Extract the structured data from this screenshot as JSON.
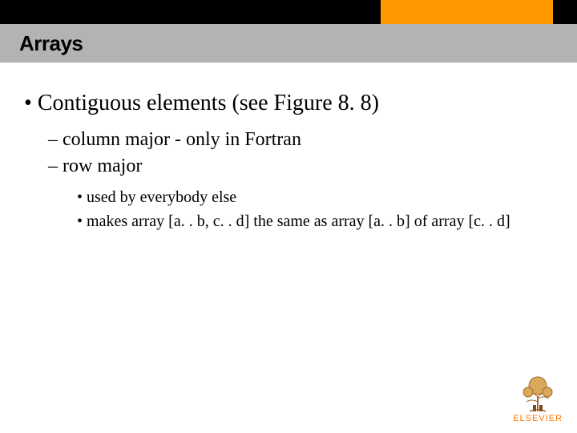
{
  "header": {
    "title": "Arrays"
  },
  "content": {
    "b1": "Contiguous elements (see Figure 8. 8)",
    "b1_1": "column major - only in Fortran",
    "b1_2": "row major",
    "b1_2_1": "used by everybody else",
    "b1_2_2": "makes array [a. . b, c. . d] the same as array [a. . b] of array [c. . d]"
  },
  "branding": {
    "publisher": "ELSEVIER"
  }
}
